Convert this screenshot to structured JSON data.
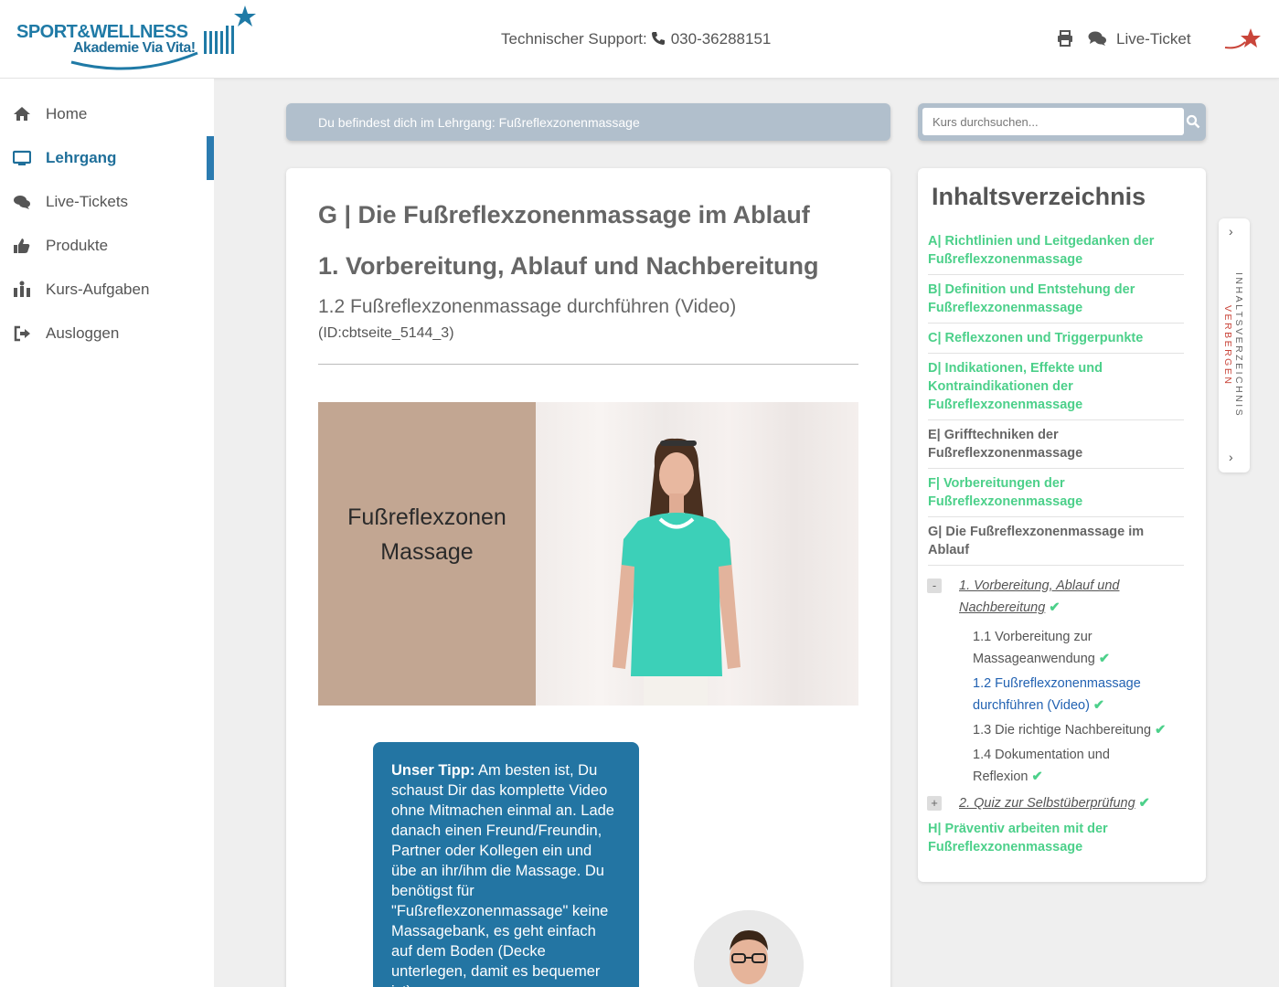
{
  "header": {
    "logo_line1": "SPORT&WELLNESS",
    "logo_line2": "Akademie Via Vita!",
    "support_label": "Technischer Support:",
    "support_phone": "030-36288151",
    "live_ticket": "Live-Ticket",
    "icons": [
      "print-icon",
      "comments-icon",
      "star-logo-icon"
    ]
  },
  "sidebar": {
    "items": [
      {
        "label": "Home",
        "icon": "home-icon"
      },
      {
        "label": "Lehrgang",
        "icon": "monitor-icon",
        "active": true
      },
      {
        "label": "Live-Tickets",
        "icon": "comments-icon"
      },
      {
        "label": "Produkte",
        "icon": "thumbs-up-icon"
      },
      {
        "label": "Kurs-Aufgaben",
        "icon": "tasks-icon"
      },
      {
        "label": "Ausloggen",
        "icon": "sign-out-icon"
      }
    ]
  },
  "breadcrumb": {
    "text": "Du befindest dich im Lehrgang: Fußreflexzonenmassage"
  },
  "search": {
    "placeholder": "Kurs durchsuchen..."
  },
  "content": {
    "chapter": "G | Die Fußreflexzonenmassage im Ablauf",
    "section": "1. Vorbereitung, Ablauf und Nachbereitung",
    "page": "1.2 Fußreflexzonenmassage durchführen (Video)",
    "page_id": "(ID:cbtseite_5144_3)",
    "video_title_1": "Fußreflexzonen",
    "video_title_2": "Massage",
    "tip_label": "Unser Tipp:",
    "tip_text": " Am besten ist, Du schaust Dir das komplette Video ohne Mitmachen einmal an. Lade danach einen Freund/Freundin, Partner oder Kollegen ein und übe an ihr/ihm die Massage. Du benötigst für \"Fußreflexzonenmassage\" keine Massagebank, es geht einfach auf dem Boden (Decke unterlegen, damit es bequemer ist)."
  },
  "toc": {
    "title": "Inhaltsverzeichnis",
    "chapters": [
      {
        "label": "A| Richtlinien und Leitgedanken der Fußreflexzonenmassage",
        "color": "#4cd08a"
      },
      {
        "label": "B| Definition und Entstehung der Fußreflexzonenmassage",
        "color": "#4cd08a"
      },
      {
        "label": "C| Reflexzonen und Triggerpunkte",
        "color": "#4cd08a"
      },
      {
        "label": "D| Indikationen, Effekte und Kontraindikationen der Fußreflexzonenmassage",
        "color": "#4cd08a"
      },
      {
        "label": "E| Grifftechniken der Fußreflexzonenmassage",
        "color": "#666666"
      },
      {
        "label": "F| Vorbereitungen der Fußreflexzonenmassage",
        "color": "#4cd08a"
      },
      {
        "label": "G| Die Fußreflexzonenmassage im Ablauf",
        "color": "#666666"
      }
    ],
    "sections": [
      {
        "toggle": "-",
        "label": "1. Vorbereitung, Ablauf und Nachbereitung"
      },
      {
        "toggle": "+",
        "label": "2. Quiz zur Selbstüberprüfung"
      }
    ],
    "pages": [
      {
        "label": "1.1 Vorbereitung zur Massageanwendung"
      },
      {
        "label": "1.2 Fußreflexzonenmassage durchführen (Video)",
        "current": true
      },
      {
        "label": "1.3 Die richtige Nachbereitung"
      },
      {
        "label": "1.4 Dokumentation und Reflexion"
      }
    ],
    "last_chapter": "H| Präventiv arbeiten mit der Fußreflexzonenmassage",
    "check": "✔"
  },
  "sidetab": {
    "label": "INHALTSVERZEICHNIS",
    "action": "VERBERGEN"
  }
}
